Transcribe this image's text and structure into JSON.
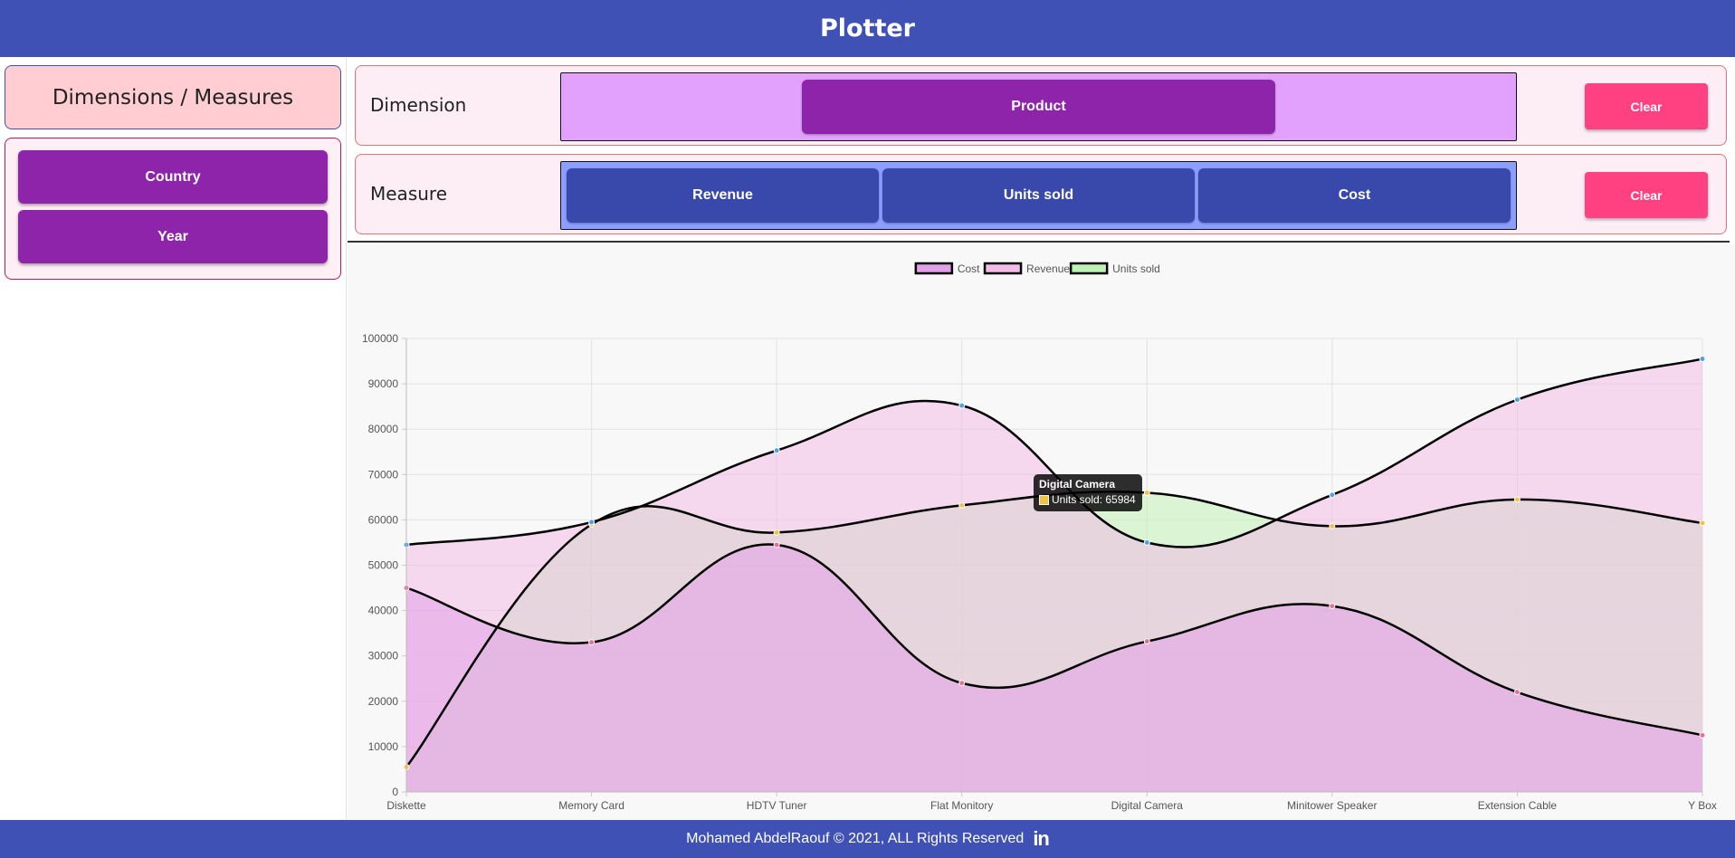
{
  "app": {
    "title": "Plotter"
  },
  "sidebar": {
    "title": "Dimensions / Measures",
    "items": [
      {
        "label": "Country"
      },
      {
        "label": "Year"
      }
    ]
  },
  "slots": {
    "dimension": {
      "label": "Dimension",
      "chips": [
        "Product"
      ],
      "clear_label": "Clear"
    },
    "measure": {
      "label": "Measure",
      "chips": [
        "Revenue",
        "Units sold",
        "Cost"
      ],
      "clear_label": "Clear"
    }
  },
  "chart_data": {
    "type": "area",
    "categories": [
      "Diskette",
      "Memory Card",
      "HDTV Tuner",
      "Flat Monitory",
      "Digital Camera",
      "Minitower Speaker",
      "Extension Cable",
      "Y Box"
    ],
    "series": [
      {
        "name": "Cost",
        "values": [
          45000,
          33000,
          54500,
          24000,
          33200,
          41000,
          22000,
          12500
        ],
        "color": "#e57390"
      },
      {
        "name": "Revenue",
        "values": [
          54500,
          59500,
          75300,
          85200,
          55000,
          65500,
          86500,
          95500
        ],
        "color": "#4aa5e8"
      },
      {
        "name": "Units sold",
        "values": [
          5500,
          59000,
          57200,
          63200,
          65984,
          58600,
          64500,
          59300
        ],
        "color": "#f5c043"
      }
    ],
    "ylim": [
      0,
      100000
    ],
    "yticks": [
      "0",
      "10000",
      "20000",
      "30000",
      "40000",
      "50000",
      "60000",
      "70000",
      "80000",
      "90000",
      "100000"
    ],
    "legend": "top-center",
    "grid": true,
    "fill_colors": {
      "Cost": "#e1a1e8",
      "Revenue": "#f2bce6",
      "Units sold": "#c1f0b6"
    }
  },
  "tooltip": {
    "title": "Digital Camera",
    "body": "Units sold: 65984"
  },
  "footer": {
    "text": "Mohamed AbdelRaouf © 2021, ALL Rights Reserved",
    "icon": "linkedin-icon",
    "icon_text": "in"
  }
}
